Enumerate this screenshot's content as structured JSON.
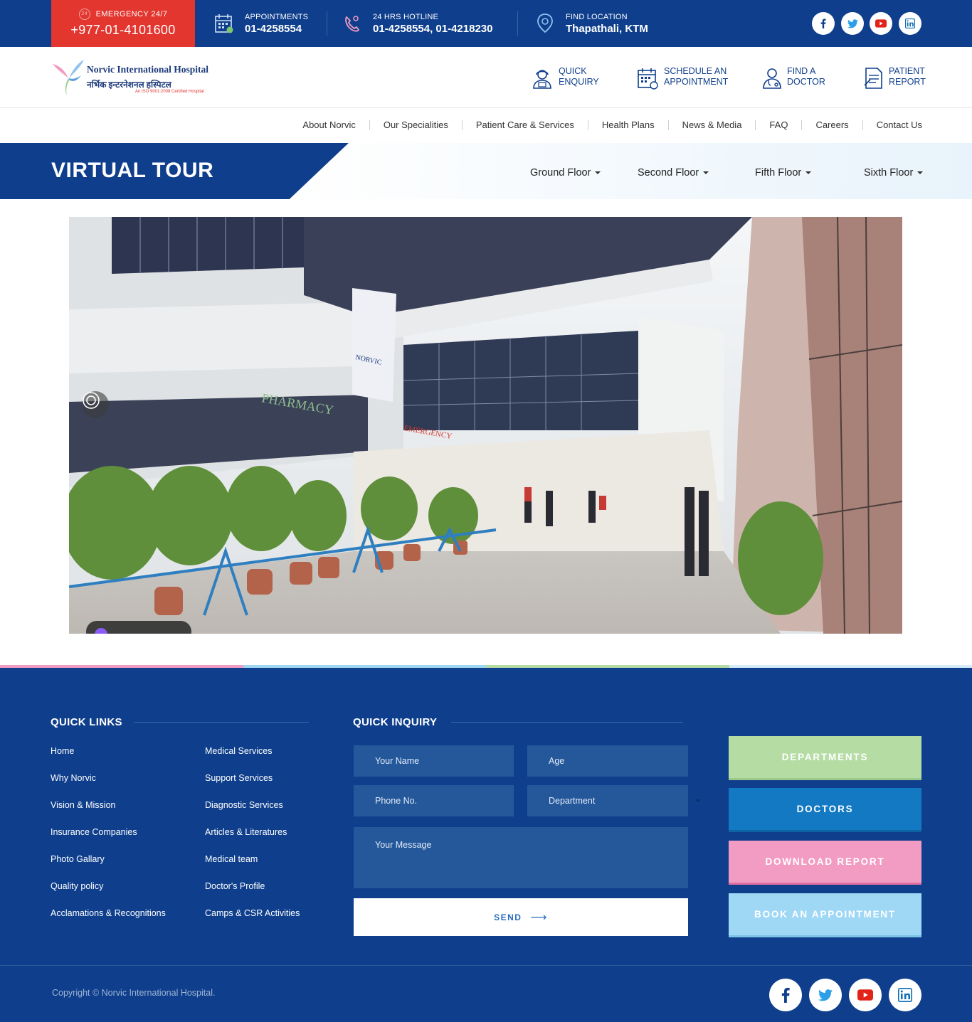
{
  "topbar": {
    "emergency": {
      "label": "EMERGENCY 24/7",
      "badge": "24",
      "number": "+977-01-4101600"
    },
    "appointments": {
      "label": "APPOINTMENTS",
      "value": "01-4258554"
    },
    "hotline": {
      "label": "24 HRS HOTLINE",
      "value": "01-4258554, 01-4218230"
    },
    "location": {
      "label": "FIND LOCATION",
      "value": "Thapathali, KTM"
    },
    "social": [
      "facebook-icon",
      "twitter-icon",
      "youtube-icon",
      "linkedin-icon"
    ]
  },
  "header": {
    "logo": {
      "name_en": "Norvic International Hospital",
      "name_np": "नर्भिक इन्टरनेशनल हस्पिटल",
      "tagline": "An ISO 9001:2008 Certified Hospital"
    },
    "quick": [
      {
        "line1": "QUICK",
        "line2": "ENQUIRY"
      },
      {
        "line1": "SCHEDULE AN",
        "line2": "APPOINTMENT"
      },
      {
        "line1": "FIND A",
        "line2": "DOCTOR"
      },
      {
        "line1": "PATIENT",
        "line2": "REPORT"
      }
    ]
  },
  "nav": [
    "About Norvic",
    "Our Specialities",
    "Patient Care & Services",
    "Health Plans",
    "News & Media",
    "FAQ",
    "Careers",
    "Contact Us"
  ],
  "page": {
    "title": "VIRTUAL TOUR",
    "floors": [
      "Ground Floor",
      "Second Floor",
      "Fifth Floor",
      "Sixth Floor"
    ]
  },
  "footer": {
    "quick_links_title": "QUICK LINKS",
    "links_col1": [
      "Home",
      "Why Norvic",
      "Vision & Mission",
      "Insurance Companies",
      "Photo Gallary",
      "Quality policy",
      "Acclamations & Recognitions"
    ],
    "links_col2": [
      "Medical Services",
      "Support Services",
      "Diagnostic Services",
      "Articles & Literatures",
      "Medical team",
      "Doctor's Profile",
      "Camps & CSR Activities"
    ],
    "inquiry_title": "QUICK INQUIRY",
    "form": {
      "name": "Your Name",
      "age": "Age",
      "phone": "Phone No.",
      "department": "Department",
      "message": "Your Message",
      "send": "SEND"
    },
    "cta": [
      "DEPARTMENTS",
      "DOCTORS",
      "DOWNLOAD REPORT",
      "BOOK AN APPOINTMENT"
    ],
    "copyright": "Copyright © Norvic International Hospital."
  },
  "colors": {
    "primary": "#0f3f8c",
    "emergency": "#e2362f",
    "departments": "#b4dca3",
    "doctors": "#1379c2",
    "download": "#f29cc3",
    "book": "#9fd8f5"
  }
}
